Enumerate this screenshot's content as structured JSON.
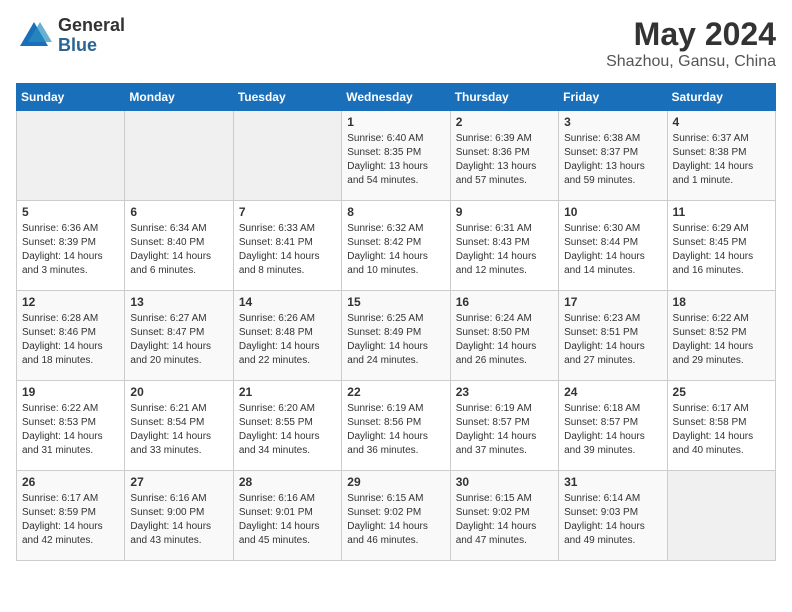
{
  "logo": {
    "general": "General",
    "blue": "Blue"
  },
  "title": "May 2024",
  "subtitle": "Shazhou, Gansu, China",
  "weekdays": [
    "Sunday",
    "Monday",
    "Tuesday",
    "Wednesday",
    "Thursday",
    "Friday",
    "Saturday"
  ],
  "weeks": [
    [
      {
        "day": "",
        "info": ""
      },
      {
        "day": "",
        "info": ""
      },
      {
        "day": "",
        "info": ""
      },
      {
        "day": "1",
        "info": "Sunrise: 6:40 AM\nSunset: 8:35 PM\nDaylight: 13 hours\nand 54 minutes."
      },
      {
        "day": "2",
        "info": "Sunrise: 6:39 AM\nSunset: 8:36 PM\nDaylight: 13 hours\nand 57 minutes."
      },
      {
        "day": "3",
        "info": "Sunrise: 6:38 AM\nSunset: 8:37 PM\nDaylight: 13 hours\nand 59 minutes."
      },
      {
        "day": "4",
        "info": "Sunrise: 6:37 AM\nSunset: 8:38 PM\nDaylight: 14 hours\nand 1 minute."
      }
    ],
    [
      {
        "day": "5",
        "info": "Sunrise: 6:36 AM\nSunset: 8:39 PM\nDaylight: 14 hours\nand 3 minutes."
      },
      {
        "day": "6",
        "info": "Sunrise: 6:34 AM\nSunset: 8:40 PM\nDaylight: 14 hours\nand 6 minutes."
      },
      {
        "day": "7",
        "info": "Sunrise: 6:33 AM\nSunset: 8:41 PM\nDaylight: 14 hours\nand 8 minutes."
      },
      {
        "day": "8",
        "info": "Sunrise: 6:32 AM\nSunset: 8:42 PM\nDaylight: 14 hours\nand 10 minutes."
      },
      {
        "day": "9",
        "info": "Sunrise: 6:31 AM\nSunset: 8:43 PM\nDaylight: 14 hours\nand 12 minutes."
      },
      {
        "day": "10",
        "info": "Sunrise: 6:30 AM\nSunset: 8:44 PM\nDaylight: 14 hours\nand 14 minutes."
      },
      {
        "day": "11",
        "info": "Sunrise: 6:29 AM\nSunset: 8:45 PM\nDaylight: 14 hours\nand 16 minutes."
      }
    ],
    [
      {
        "day": "12",
        "info": "Sunrise: 6:28 AM\nSunset: 8:46 PM\nDaylight: 14 hours\nand 18 minutes."
      },
      {
        "day": "13",
        "info": "Sunrise: 6:27 AM\nSunset: 8:47 PM\nDaylight: 14 hours\nand 20 minutes."
      },
      {
        "day": "14",
        "info": "Sunrise: 6:26 AM\nSunset: 8:48 PM\nDaylight: 14 hours\nand 22 minutes."
      },
      {
        "day": "15",
        "info": "Sunrise: 6:25 AM\nSunset: 8:49 PM\nDaylight: 14 hours\nand 24 minutes."
      },
      {
        "day": "16",
        "info": "Sunrise: 6:24 AM\nSunset: 8:50 PM\nDaylight: 14 hours\nand 26 minutes."
      },
      {
        "day": "17",
        "info": "Sunrise: 6:23 AM\nSunset: 8:51 PM\nDaylight: 14 hours\nand 27 minutes."
      },
      {
        "day": "18",
        "info": "Sunrise: 6:22 AM\nSunset: 8:52 PM\nDaylight: 14 hours\nand 29 minutes."
      }
    ],
    [
      {
        "day": "19",
        "info": "Sunrise: 6:22 AM\nSunset: 8:53 PM\nDaylight: 14 hours\nand 31 minutes."
      },
      {
        "day": "20",
        "info": "Sunrise: 6:21 AM\nSunset: 8:54 PM\nDaylight: 14 hours\nand 33 minutes."
      },
      {
        "day": "21",
        "info": "Sunrise: 6:20 AM\nSunset: 8:55 PM\nDaylight: 14 hours\nand 34 minutes."
      },
      {
        "day": "22",
        "info": "Sunrise: 6:19 AM\nSunset: 8:56 PM\nDaylight: 14 hours\nand 36 minutes."
      },
      {
        "day": "23",
        "info": "Sunrise: 6:19 AM\nSunset: 8:57 PM\nDaylight: 14 hours\nand 37 minutes."
      },
      {
        "day": "24",
        "info": "Sunrise: 6:18 AM\nSunset: 8:57 PM\nDaylight: 14 hours\nand 39 minutes."
      },
      {
        "day": "25",
        "info": "Sunrise: 6:17 AM\nSunset: 8:58 PM\nDaylight: 14 hours\nand 40 minutes."
      }
    ],
    [
      {
        "day": "26",
        "info": "Sunrise: 6:17 AM\nSunset: 8:59 PM\nDaylight: 14 hours\nand 42 minutes."
      },
      {
        "day": "27",
        "info": "Sunrise: 6:16 AM\nSunset: 9:00 PM\nDaylight: 14 hours\nand 43 minutes."
      },
      {
        "day": "28",
        "info": "Sunrise: 6:16 AM\nSunset: 9:01 PM\nDaylight: 14 hours\nand 45 minutes."
      },
      {
        "day": "29",
        "info": "Sunrise: 6:15 AM\nSunset: 9:02 PM\nDaylight: 14 hours\nand 46 minutes."
      },
      {
        "day": "30",
        "info": "Sunrise: 6:15 AM\nSunset: 9:02 PM\nDaylight: 14 hours\nand 47 minutes."
      },
      {
        "day": "31",
        "info": "Sunrise: 6:14 AM\nSunset: 9:03 PM\nDaylight: 14 hours\nand 49 minutes."
      },
      {
        "day": "",
        "info": ""
      }
    ]
  ]
}
